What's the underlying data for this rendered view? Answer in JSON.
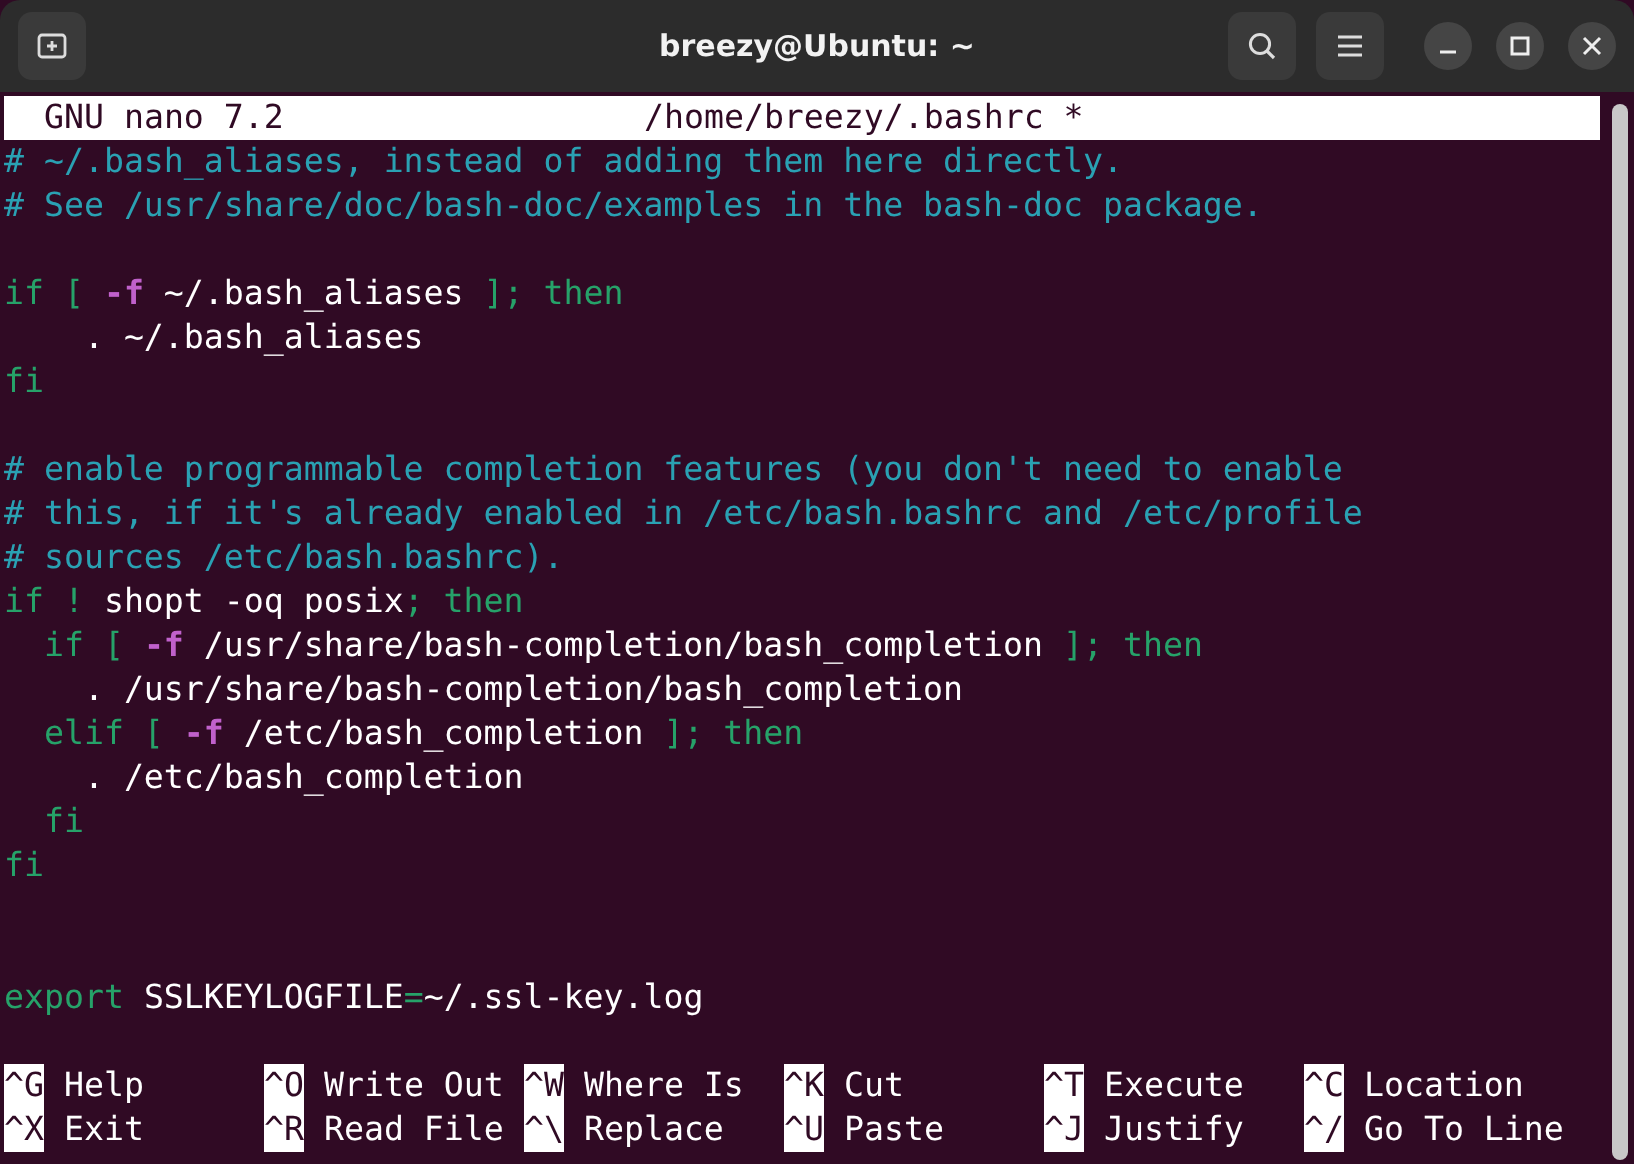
{
  "window": {
    "title": "breezy@Ubuntu: ~"
  },
  "header": {
    "version": "GNU nano 7.2",
    "file": "/home/breezy/.bashrc *"
  },
  "lines": [
    {
      "kind": "code",
      "segments": [
        {
          "kind": "comment",
          "text": "# ~/.bash_aliases, instead of adding them here directly."
        }
      ]
    },
    {
      "kind": "code",
      "segments": [
        {
          "kind": "comment",
          "text": "# See /usr/share/doc/bash-doc/examples in the bash-doc package."
        }
      ]
    },
    {
      "kind": "blank"
    },
    {
      "kind": "code",
      "segments": [
        {
          "kind": "keyword",
          "text": "if [ "
        },
        {
          "kind": "flag",
          "text": "-f"
        },
        {
          "kind": "plain",
          "text": " ~/.bash_aliases "
        },
        {
          "kind": "keyword",
          "text": "]; then"
        }
      ]
    },
    {
      "kind": "code",
      "segments": [
        {
          "kind": "plain",
          "text": "    . ~/.bash_aliases"
        }
      ]
    },
    {
      "kind": "code",
      "segments": [
        {
          "kind": "keyword",
          "text": "fi"
        }
      ]
    },
    {
      "kind": "blank"
    },
    {
      "kind": "code",
      "segments": [
        {
          "kind": "comment",
          "text": "# enable programmable completion features (you don't need to enable"
        }
      ]
    },
    {
      "kind": "code",
      "segments": [
        {
          "kind": "comment",
          "text": "# this, if it's already enabled in /etc/bash.bashrc and /etc/profile"
        }
      ]
    },
    {
      "kind": "code",
      "segments": [
        {
          "kind": "comment",
          "text": "# sources /etc/bash.bashrc)."
        }
      ]
    },
    {
      "kind": "code",
      "segments": [
        {
          "kind": "keyword",
          "text": "if ! "
        },
        {
          "kind": "plain",
          "text": "shopt -oq posix"
        },
        {
          "kind": "keyword",
          "text": "; then"
        }
      ]
    },
    {
      "kind": "code",
      "segments": [
        {
          "kind": "keyword",
          "text": "  if [ "
        },
        {
          "kind": "flag",
          "text": "-f"
        },
        {
          "kind": "plain",
          "text": " /usr/share/bash-completion/bash_completion "
        },
        {
          "kind": "keyword",
          "text": "]; then"
        }
      ]
    },
    {
      "kind": "code",
      "segments": [
        {
          "kind": "plain",
          "text": "    . /usr/share/bash-completion/bash_completion"
        }
      ]
    },
    {
      "kind": "code",
      "segments": [
        {
          "kind": "keyword",
          "text": "  elif [ "
        },
        {
          "kind": "flag",
          "text": "-f"
        },
        {
          "kind": "plain",
          "text": " /etc/bash_completion "
        },
        {
          "kind": "keyword",
          "text": "]; then"
        }
      ]
    },
    {
      "kind": "code",
      "segments": [
        {
          "kind": "plain",
          "text": "    . /etc/bash_completion"
        }
      ]
    },
    {
      "kind": "code",
      "segments": [
        {
          "kind": "keyword",
          "text": "  fi"
        }
      ]
    },
    {
      "kind": "code",
      "segments": [
        {
          "kind": "keyword",
          "text": "fi"
        }
      ]
    },
    {
      "kind": "blank"
    },
    {
      "kind": "blank"
    },
    {
      "kind": "code",
      "segments": [
        {
          "kind": "keyword",
          "text": "export"
        },
        {
          "kind": "plain",
          "text": " SSLKEYLOGFILE"
        },
        {
          "kind": "keyword",
          "text": "="
        },
        {
          "kind": "plain",
          "text": "~/.ssl-key.log"
        }
      ]
    }
  ],
  "shortcuts": [
    {
      "key": "^G",
      "label": "Help"
    },
    {
      "key": "^O",
      "label": "Write Out"
    },
    {
      "key": "^W",
      "label": "Where Is"
    },
    {
      "key": "^K",
      "label": "Cut"
    },
    {
      "key": "^T",
      "label": "Execute"
    },
    {
      "key": "^C",
      "label": "Location"
    },
    {
      "key": "^X",
      "label": "Exit"
    },
    {
      "key": "^R",
      "label": "Read File"
    },
    {
      "key": "^\\",
      "label": "Replace"
    },
    {
      "key": "^U",
      "label": "Paste"
    },
    {
      "key": "^J",
      "label": "Justify"
    },
    {
      "key": "^/",
      "label": "Go To Line"
    }
  ]
}
